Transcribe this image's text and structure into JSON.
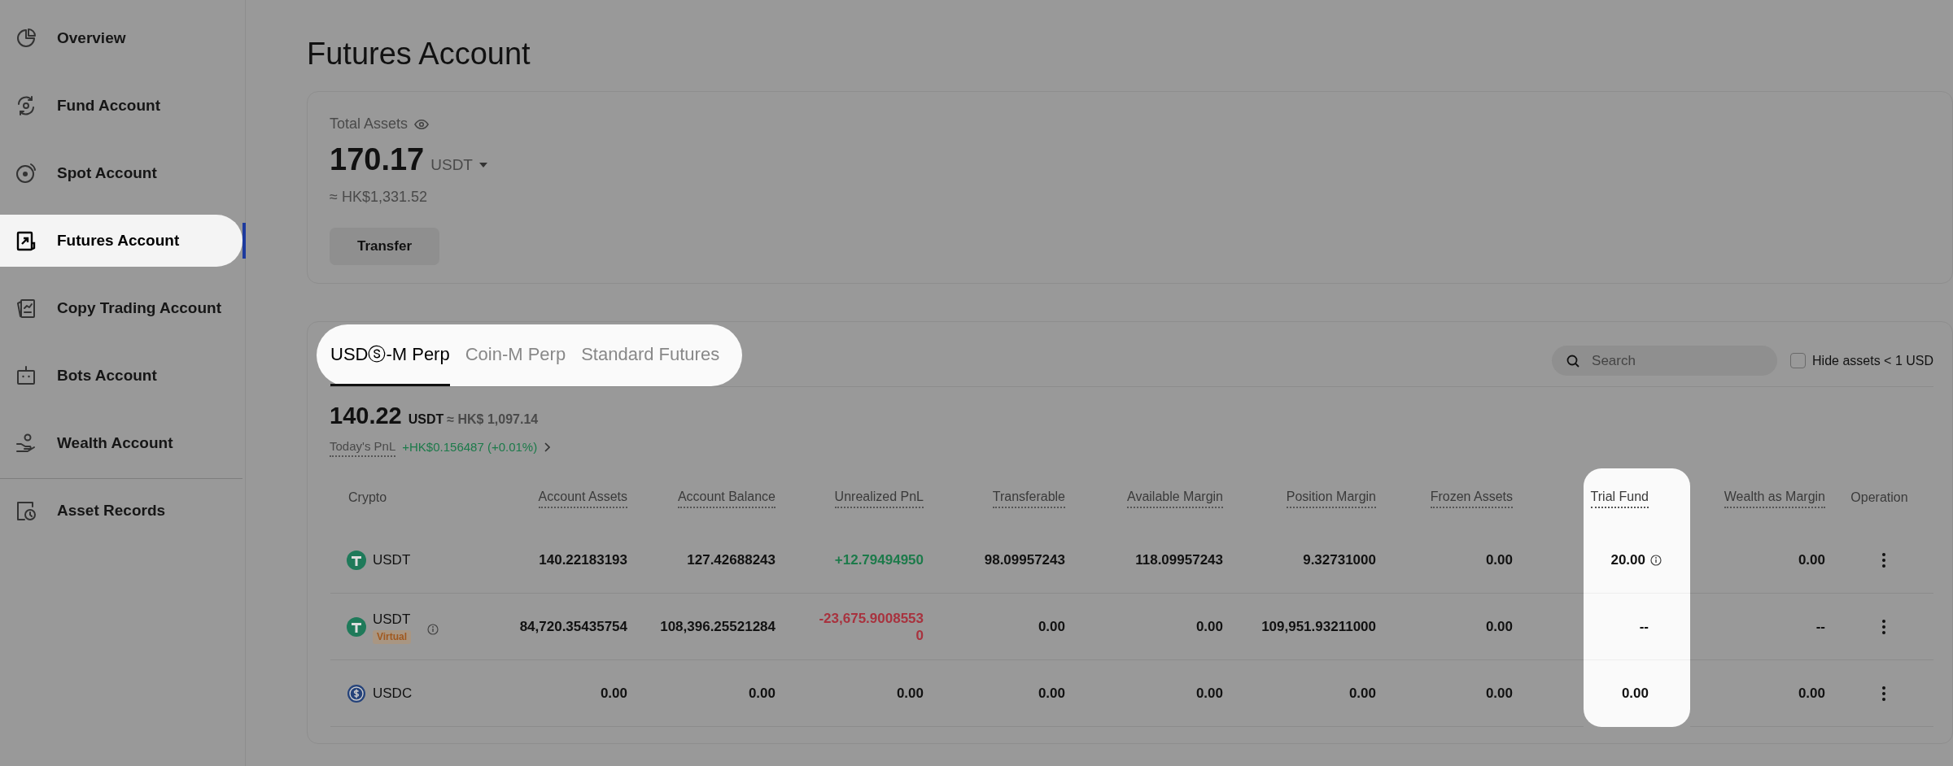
{
  "sidebar": {
    "items": [
      {
        "label": "Overview",
        "selected": false,
        "divider_before": false
      },
      {
        "label": "Fund Account",
        "selected": false,
        "divider_before": false
      },
      {
        "label": "Spot Account",
        "selected": false,
        "divider_before": false
      },
      {
        "label": "Futures Account",
        "selected": true,
        "divider_before": false
      },
      {
        "label": "Copy Trading Account",
        "selected": false,
        "divider_before": false
      },
      {
        "label": "Bots Account",
        "selected": false,
        "divider_before": false
      },
      {
        "label": "Wealth Account",
        "selected": false,
        "divider_before": false
      },
      {
        "label": "Asset Records",
        "selected": false,
        "divider_before": true
      }
    ]
  },
  "page_title": "Futures Account",
  "summary": {
    "label": "Total Assets",
    "amount": "170.17",
    "currency": "USDT",
    "approx": "≈ HK$1,331.52",
    "button": "Transfer"
  },
  "account": {
    "tabs": {
      "spotlight": true,
      "items": [
        {
          "label": "USDⓢ-M Perp",
          "selected": true
        },
        {
          "label": "Coin-M Perp",
          "selected": false
        },
        {
          "label": "Standard Futures",
          "selected": false
        }
      ]
    },
    "search": {
      "placeholder": "Search"
    },
    "hide_small": {
      "label": "Hide assets < 1 USD",
      "checked": false
    },
    "balance": {
      "amount": "140.22",
      "unit": "USDT",
      "approx": "≈ HK$ 1,097.14"
    },
    "pnl": {
      "label": "Today's PnL",
      "value": "+HK$0.156487 (+0.01%)"
    },
    "table": {
      "columns": [
        {
          "label": "Crypto",
          "dotted": false,
          "spotlight": false
        },
        {
          "label": "Account Assets",
          "dotted": true,
          "spotlight": false
        },
        {
          "label": "Account Balance",
          "dotted": true,
          "spotlight": false
        },
        {
          "label": "Unrealized PnL",
          "dotted": true,
          "spotlight": false
        },
        {
          "label": "Transferable",
          "dotted": true,
          "spotlight": false
        },
        {
          "label": "Available Margin",
          "dotted": true,
          "spotlight": false
        },
        {
          "label": "Position Margin",
          "dotted": true,
          "spotlight": false
        },
        {
          "label": "Frozen Assets",
          "dotted": true,
          "spotlight": false
        },
        {
          "label": "Trial Fund",
          "dotted": true,
          "spotlight": true
        },
        {
          "label": "Wealth as Margin",
          "dotted": true,
          "spotlight": false
        },
        {
          "label": "Operation",
          "dotted": false,
          "spotlight": false
        }
      ],
      "rows": [
        {
          "cells": [
            {
              "text": "USDT"
            },
            {
              "text": "140.22183193"
            },
            {
              "text": "127.42688243"
            },
            {
              "text": "+12.79494950",
              "color": "#1c7a4a"
            },
            {
              "text": "98.09957243"
            },
            {
              "text": "118.09957243"
            },
            {
              "text": "9.32731000"
            },
            {
              "text": "0.00"
            },
            {
              "text": "20.00",
              "info": true
            },
            {
              "text": "0.00"
            }
          ]
        },
        {
          "cells": [
            {
              "text": "USDT",
              "tag": "Virtual",
              "info": true
            },
            {
              "text": "84,720.35435754"
            },
            {
              "text": "108,396.25521284"
            },
            {
              "text": "-23,675.9008553 0",
              "color": "#a8323e"
            },
            {
              "text": "0.00"
            },
            {
              "text": "0.00"
            },
            {
              "text": "109,951.93211000"
            },
            {
              "text": "0.00"
            },
            {
              "text": "--"
            },
            {
              "text": "--"
            }
          ]
        },
        {
          "cells": [
            {
              "text": "USDC"
            },
            {
              "text": "0.00"
            },
            {
              "text": "0.00"
            },
            {
              "text": "0.00"
            },
            {
              "text": "0.00"
            },
            {
              "text": "0.00"
            },
            {
              "text": "0.00"
            },
            {
              "text": "0.00"
            },
            {
              "text": "0.00"
            },
            {
              "text": "0.00"
            }
          ]
        }
      ]
    }
  }
}
